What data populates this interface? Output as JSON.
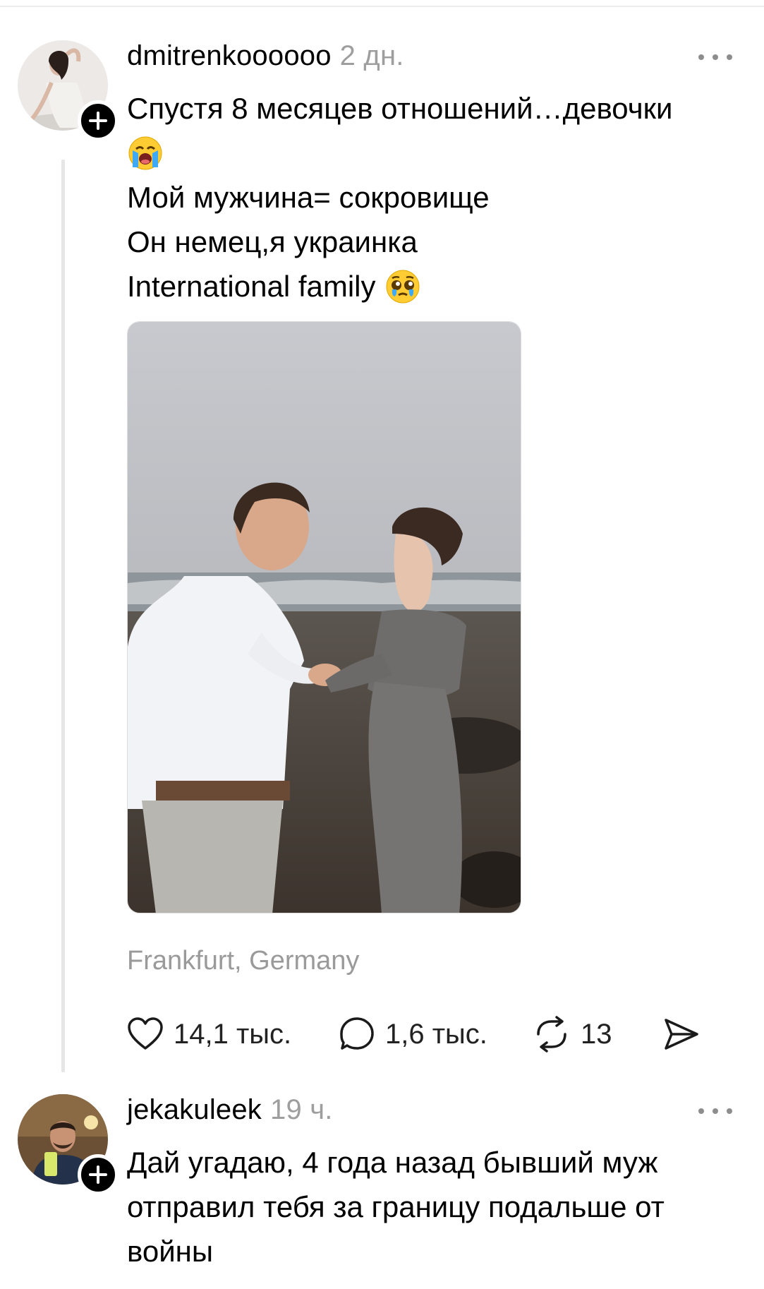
{
  "post": {
    "username": "dmitrenkoooooo",
    "time": "2 дн.",
    "text_lines": [
      "Спустя 8 месяцев отношений…девочки",
      "",
      "Мой мужчина= сокровище",
      "Он немец,я украинка",
      "International family"
    ],
    "emojis": [
      "loudly-crying-face",
      "pleading-face-with-tears"
    ],
    "location": "Frankfurt, Germany",
    "actions": {
      "likes": "14,1 тыс.",
      "comments": "1,6 тыс.",
      "reposts": "13"
    }
  },
  "reply": {
    "username": "jekakuleek",
    "time": "19 ч.",
    "text_lines": [
      "Дай угадаю, 4 года назад бывший муж",
      "отправил тебя за границу подальше от",
      "войны"
    ]
  },
  "icons": {
    "more": "more-dots-icon",
    "like": "heart-icon",
    "comment": "comment-bubble-icon",
    "repost": "repost-icon",
    "share": "send-icon",
    "follow": "plus-icon"
  },
  "colors": {
    "muted": "#9e9e9e",
    "thread_line": "#e6e6e6",
    "badge": "#000000"
  }
}
